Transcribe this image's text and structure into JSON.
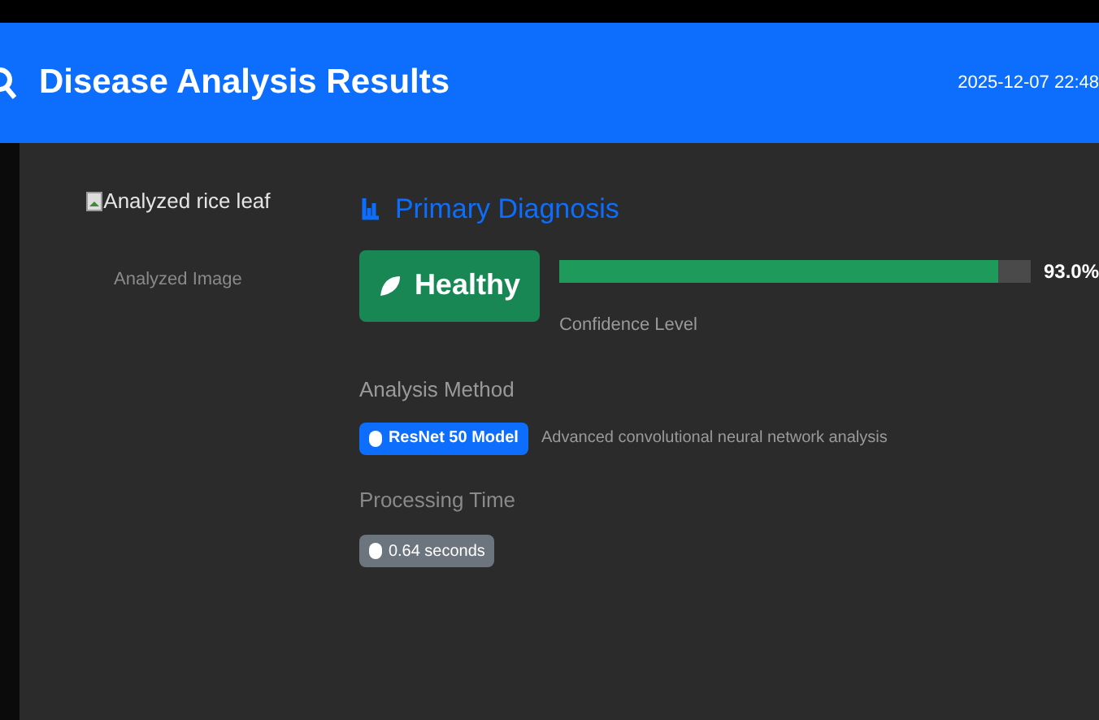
{
  "header": {
    "title": "Disease Analysis Results",
    "timestamp": "2025-12-07 22:48"
  },
  "image": {
    "alt": "Analyzed rice leaf",
    "caption": "Analyzed Image"
  },
  "diagnosis": {
    "heading": "Primary Diagnosis",
    "result": "Healthy",
    "level": 0.93,
    "reading": "93.0%",
    "confidence_label": "Confidence Level"
  },
  "method": {
    "label": "Analysis Method",
    "badge": "ResNet 50 Model",
    "description": "Advanced convolutional neural network analysis"
  },
  "processing": {
    "label": "Processing Time",
    "badge": "0.64 seconds"
  }
}
